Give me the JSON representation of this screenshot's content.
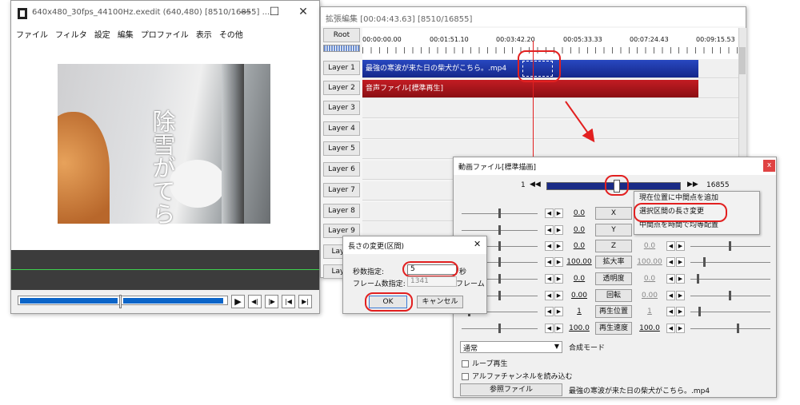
{
  "main_window": {
    "title": "640x480_30fps_44100Hz.exedit (640,480)  [8510/16855] ...",
    "menu": [
      "ファイル",
      "フィルタ",
      "設定",
      "編集",
      "プロファイル",
      "表示",
      "その他"
    ],
    "overlay_text": "除雪がてら",
    "controls": [
      "▶",
      "◀|",
      "|▶",
      "|◀",
      "▶|"
    ]
  },
  "timeline": {
    "title": "拡張編集 [00:04:43.63] [8510/16855]",
    "root_label": "Root",
    "ruler_times": [
      "00:00:00.00",
      "00:01:51.10",
      "00:03:42.20",
      "00:05:33.33",
      "00:07:24.43",
      "00:09:15.53"
    ],
    "layers": [
      "Layer 1",
      "Layer 2",
      "Layer 3",
      "Layer 4",
      "Layer 5",
      "Layer 6",
      "Layer 7",
      "Layer 8",
      "Layer 9",
      "Layer",
      "Layer"
    ],
    "clip_video": "最強の寒波が来た日の柴犬がこちら。.mp4",
    "clip_audio": "音声ファイル[標準再生]",
    "colors": {
      "video_clip": "#1e39a8",
      "audio_clip": "#b0141a",
      "annotation": "#e22020"
    }
  },
  "object_panel": {
    "title": "動画ファイル[標準描画]",
    "frame_start": "1",
    "frame_end": "16855",
    "params": [
      {
        "value": "0.0",
        "label": "X",
        "right": ""
      },
      {
        "value": "0.0",
        "label": "Y",
        "right": ""
      },
      {
        "value": "0.0",
        "label": "Z",
        "right": "0.0"
      },
      {
        "value": "100.00",
        "label": "拡大率",
        "right": "100.00"
      },
      {
        "value": "0.0",
        "label": "透明度",
        "right": "0.0"
      },
      {
        "value": "0.00",
        "label": "回転",
        "right": "0.00"
      },
      {
        "value": "1",
        "label": "再生位置",
        "right": "1"
      },
      {
        "value": "100.0",
        "label": "再生速度",
        "right": "100.0"
      }
    ],
    "blend_mode": "通常",
    "blend_label": "合成モード",
    "loop_label": "ループ再生",
    "alpha_label": "アルファチャンネルを読み込む",
    "ref_button": "参照ファイル",
    "file_name": "最強の寒波が来た日の柴犬がこちら。.mp4"
  },
  "context_menu": {
    "items": [
      "現在位置に中間点を追加",
      "選択区間の長さ変更",
      "中間点を時間で均等配置"
    ]
  },
  "length_dialog": {
    "title": "長さの変更(区間)",
    "seconds_label": "秒数指定:",
    "seconds_value": "5",
    "seconds_unit": "秒",
    "frames_label": "フレーム数指定:",
    "frames_value": "1341",
    "frames_unit": "フレーム",
    "ok": "OK",
    "cancel": "キャンセル",
    "close": "✕"
  }
}
